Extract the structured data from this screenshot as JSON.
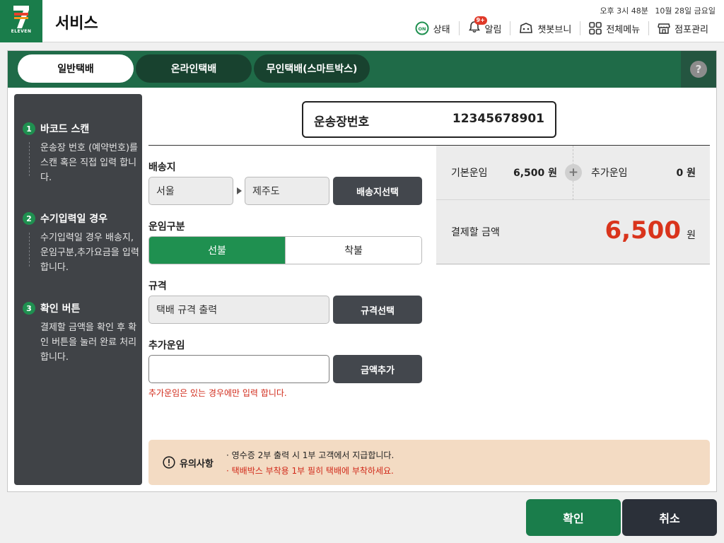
{
  "header": {
    "brand_small": "ELEVEN",
    "title": "서비스",
    "time": "오후 3시 48분",
    "date": "10월 28일 금요일",
    "nav": [
      {
        "label": "상태",
        "icon": "status-on-icon"
      },
      {
        "label": "알림",
        "icon": "bell-icon",
        "badge": "9+"
      },
      {
        "label": "챗봇브니",
        "icon": "chatbot-icon"
      },
      {
        "label": "전체메뉴",
        "icon": "grid-menu-icon"
      },
      {
        "label": "점포관리",
        "icon": "store-icon"
      }
    ],
    "status_icon_text": "ON"
  },
  "tabs": [
    {
      "label": "일반택배",
      "active": true
    },
    {
      "label": "온라인택배",
      "active": false
    },
    {
      "label": "무인택배(스마트박스)",
      "active": false
    }
  ],
  "help_label": "?",
  "guide": [
    {
      "num": "1",
      "title": "바코드 스캔",
      "desc": "운송장 번호 (예약번호)를 스캔 혹은 직접 입력 합니다."
    },
    {
      "num": "2",
      "title": "수기입력일 경우",
      "desc": "수기입력일 경우 배송지, 운임구분,추가요금을 입력 합니다."
    },
    {
      "num": "3",
      "title": "확인 버튼",
      "desc": "결제할 금액을 확인 후 확인 버튼을 눌러 완료 처리 합니다."
    }
  ],
  "tracking": {
    "label": "운송장번호",
    "value": "12345678901"
  },
  "destination": {
    "label": "배송지",
    "from": "서울",
    "to": "제주도",
    "button": "배송지선택"
  },
  "fare_type": {
    "label": "운임구분",
    "options": [
      "선불",
      "착불"
    ],
    "selected": "선불"
  },
  "size": {
    "label": "규격",
    "value": "택배 규격 출력",
    "button": "규격선택"
  },
  "extra_fee": {
    "label": "추가운임",
    "value": "",
    "button": "금액추가",
    "note": "추가운임은 있는 경우에만 입력 합니다."
  },
  "fare": {
    "base_label": "기본운임",
    "base_value": "6,500 원",
    "plus": "+",
    "extra_label": "추가운임",
    "extra_value": "0 원",
    "pay_label": "결제할 금액",
    "pay_value": "6,500",
    "pay_unit": "원"
  },
  "caution": {
    "title": "유의사항",
    "lines": [
      "· 영수증 2부 출력 시 1부 고객에서 지급합니다.",
      "· 택배박스 부착용 1부 필히 택배에 부착하세요."
    ]
  },
  "actions": {
    "confirm": "확인",
    "cancel": "취소"
  },
  "colors": {
    "brand_green": "#1f6b48",
    "accent_green": "#1f9050",
    "price_red": "#d9341c",
    "dark_button": "#43474d",
    "navy_button": "#2b3039"
  }
}
